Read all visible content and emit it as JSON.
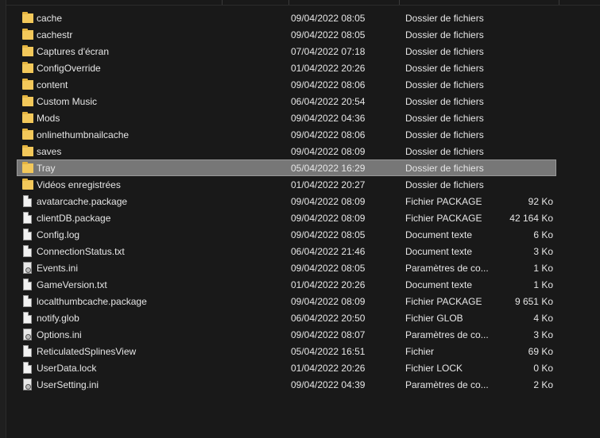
{
  "colors": {
    "background": "#191919",
    "selected_row": "#777777",
    "folder": "#f3c85a"
  },
  "files": [
    {
      "name": "cache",
      "date": "09/04/2022 08:05",
      "type": "Dossier de fichiers",
      "size": "",
      "icon": "folder-icon"
    },
    {
      "name": "cachestr",
      "date": "09/04/2022 08:05",
      "type": "Dossier de fichiers",
      "size": "",
      "icon": "folder-icon"
    },
    {
      "name": "Captures d'écran",
      "date": "07/04/2022 07:18",
      "type": "Dossier de fichiers",
      "size": "",
      "icon": "folder-icon"
    },
    {
      "name": "ConfigOverride",
      "date": "01/04/2022 20:26",
      "type": "Dossier de fichiers",
      "size": "",
      "icon": "folder-icon"
    },
    {
      "name": "content",
      "date": "09/04/2022 08:06",
      "type": "Dossier de fichiers",
      "size": "",
      "icon": "folder-icon"
    },
    {
      "name": "Custom Music",
      "date": "06/04/2022 20:54",
      "type": "Dossier de fichiers",
      "size": "",
      "icon": "folder-icon"
    },
    {
      "name": "Mods",
      "date": "09/04/2022 04:36",
      "type": "Dossier de fichiers",
      "size": "",
      "icon": "folder-icon"
    },
    {
      "name": "onlinethumbnailcache",
      "date": "09/04/2022 08:06",
      "type": "Dossier de fichiers",
      "size": "",
      "icon": "folder-icon"
    },
    {
      "name": "saves",
      "date": "09/04/2022 08:09",
      "type": "Dossier de fichiers",
      "size": "",
      "icon": "folder-icon"
    },
    {
      "name": "Tray",
      "date": "05/04/2022 16:29",
      "type": "Dossier de fichiers",
      "size": "",
      "icon": "folder-icon",
      "selected": true
    },
    {
      "name": "Vidéos enregistrées",
      "date": "01/04/2022 20:27",
      "type": "Dossier de fichiers",
      "size": "",
      "icon": "folder-icon"
    },
    {
      "name": "avatarcache.package",
      "date": "09/04/2022 08:09",
      "type": "Fichier PACKAGE",
      "size": "92 Ko",
      "icon": "file-icon"
    },
    {
      "name": "clientDB.package",
      "date": "09/04/2022 08:09",
      "type": "Fichier PACKAGE",
      "size": "42 164 Ko",
      "icon": "file-icon"
    },
    {
      "name": "Config.log",
      "date": "09/04/2022 08:05",
      "type": "Document texte",
      "size": "6 Ko",
      "icon": "file-icon"
    },
    {
      "name": "ConnectionStatus.txt",
      "date": "06/04/2022 21:46",
      "type": "Document texte",
      "size": "3 Ko",
      "icon": "file-icon"
    },
    {
      "name": "Events.ini",
      "date": "09/04/2022 08:05",
      "type": "Paramètres de co...",
      "size": "1 Ko",
      "icon": "settings-file-icon"
    },
    {
      "name": "GameVersion.txt",
      "date": "01/04/2022 20:26",
      "type": "Document texte",
      "size": "1 Ko",
      "icon": "file-icon"
    },
    {
      "name": "localthumbcache.package",
      "date": "09/04/2022 08:09",
      "type": "Fichier PACKAGE",
      "size": "9 651 Ko",
      "icon": "file-icon"
    },
    {
      "name": "notify.glob",
      "date": "06/04/2022 20:50",
      "type": "Fichier GLOB",
      "size": "4 Ko",
      "icon": "file-icon"
    },
    {
      "name": "Options.ini",
      "date": "09/04/2022 08:07",
      "type": "Paramètres de co...",
      "size": "3 Ko",
      "icon": "settings-file-icon"
    },
    {
      "name": "ReticulatedSplinesView",
      "date": "05/04/2022 16:51",
      "type": "Fichier",
      "size": "69 Ko",
      "icon": "file-icon"
    },
    {
      "name": "UserData.lock",
      "date": "01/04/2022 20:26",
      "type": "Fichier LOCK",
      "size": "0 Ko",
      "icon": "file-icon"
    },
    {
      "name": "UserSetting.ini",
      "date": "09/04/2022 04:39",
      "type": "Paramètres de co...",
      "size": "2 Ko",
      "icon": "settings-file-icon"
    }
  ]
}
